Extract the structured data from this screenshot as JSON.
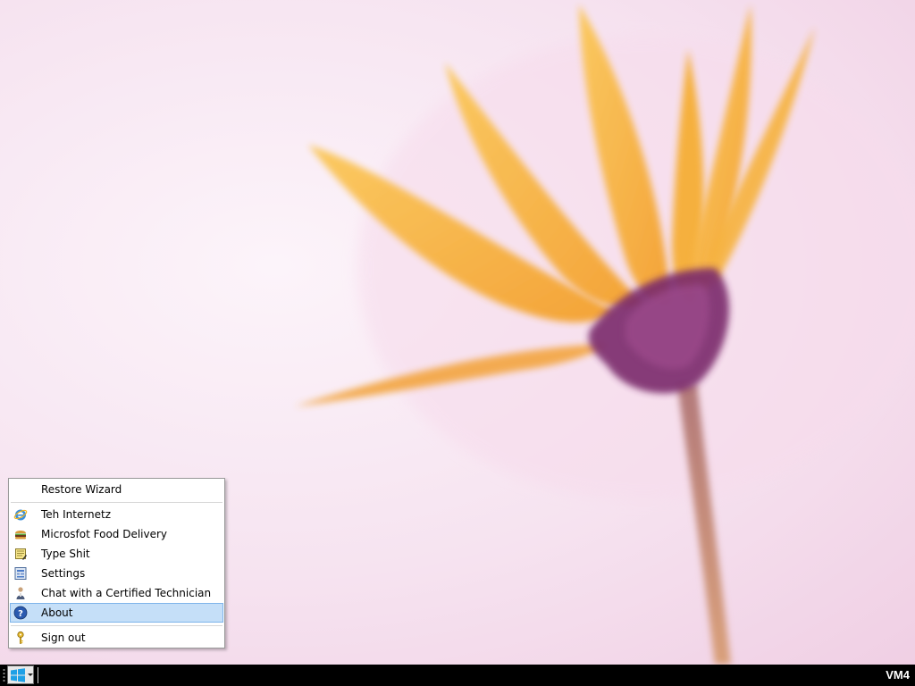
{
  "start_menu": {
    "items": [
      {
        "label": "Restore Wizard",
        "icon": "none"
      },
      {
        "label": "Teh Internetz",
        "icon": "internet-explorer-icon"
      },
      {
        "label": "Microsfot Food Delivery",
        "icon": "burger-icon"
      },
      {
        "label": "Type Shit",
        "icon": "notepad-icon"
      },
      {
        "label": "Settings",
        "icon": "settings-icon"
      },
      {
        "label": "Chat with a Certified Technician",
        "icon": "technician-icon"
      },
      {
        "label": "About",
        "icon": "help-icon",
        "selected": true
      },
      {
        "label": "Sign out",
        "icon": "key-icon"
      }
    ]
  },
  "taskbar": {
    "vm_name": "VM4",
    "start_icon": "windows-logo-icon"
  },
  "colors": {
    "taskbar": "#000000",
    "selected_item": "#c5dff8",
    "selected_border": "#7eb4ea",
    "petal": "#f7b43c",
    "flower_center": "#7a2a6c"
  }
}
